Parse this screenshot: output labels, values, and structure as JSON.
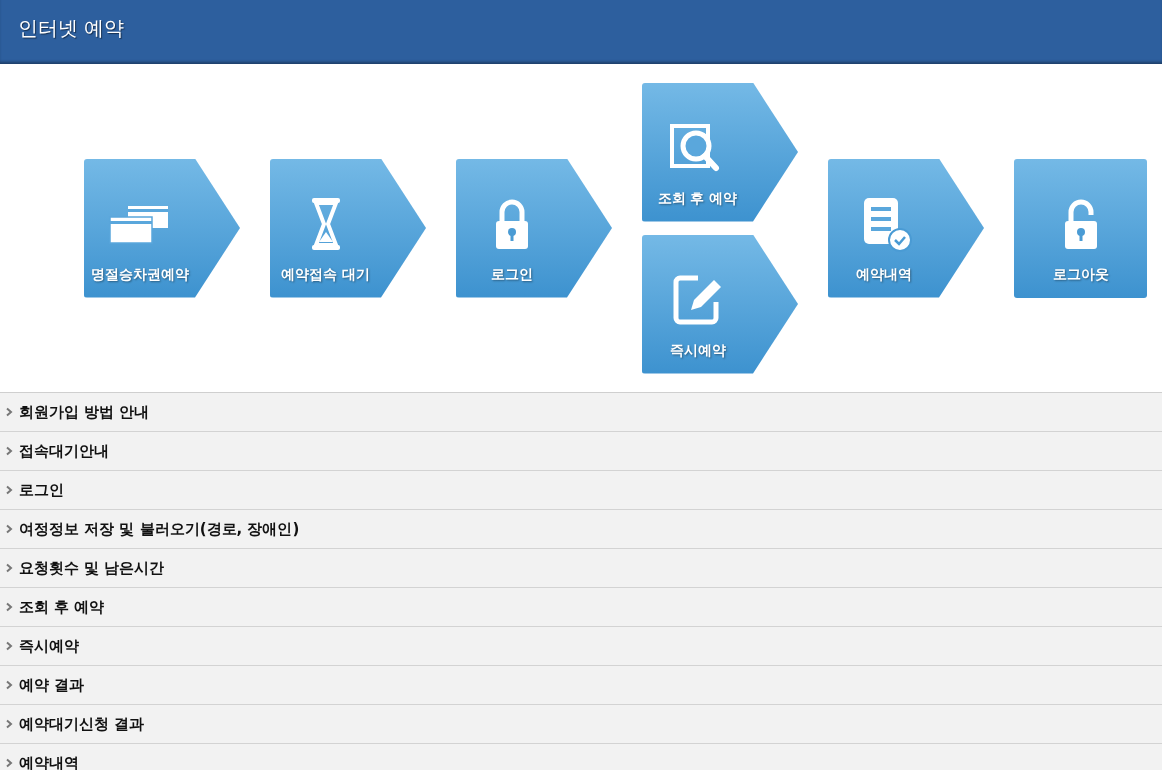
{
  "header": {
    "title": "인터넷 예약"
  },
  "steps": [
    {
      "tiles": [
        {
          "label": "명절승차권예약",
          "kind": "cards",
          "arrow": true
        }
      ]
    },
    {
      "tiles": [
        {
          "label": "예약접속 대기",
          "kind": "hourglass",
          "arrow": true
        }
      ]
    },
    {
      "tiles": [
        {
          "label": "로그인",
          "kind": "lock",
          "arrow": true
        }
      ]
    },
    {
      "tiles": [
        {
          "label": "조회 후 예약",
          "kind": "search",
          "arrow": true
        },
        {
          "label": "즉시예약",
          "kind": "edit",
          "arrow": true
        }
      ]
    },
    {
      "tiles": [
        {
          "label": "예약내역",
          "kind": "list",
          "arrow": true
        }
      ]
    },
    {
      "tiles": [
        {
          "label": "로그아웃",
          "kind": "unlock",
          "arrow": false
        }
      ]
    }
  ],
  "sections": [
    {
      "title": "회원가입 방법 안내"
    },
    {
      "title": "접속대기안내"
    },
    {
      "title": "로그인"
    },
    {
      "title": "여정정보 저장 및 불러오기(경로, 장애인)"
    },
    {
      "title": "요청횟수 및 남은시간"
    },
    {
      "title": "조회 후 예약"
    },
    {
      "title": "즉시예약"
    },
    {
      "title": "예약 결과"
    },
    {
      "title": "예약대기신청 결과"
    },
    {
      "title": "예약내역"
    }
  ]
}
